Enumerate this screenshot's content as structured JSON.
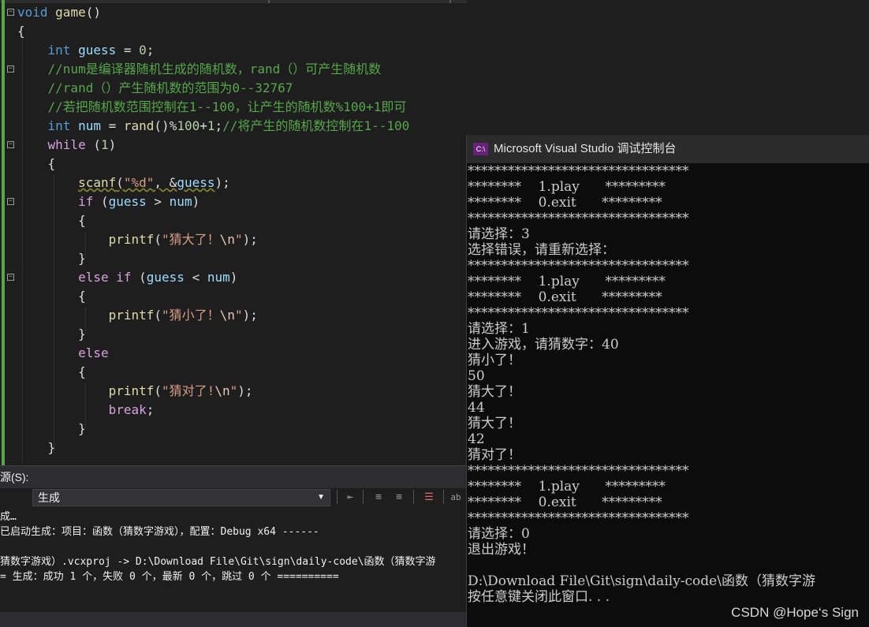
{
  "editor": {
    "lines": [
      {
        "tokens": [
          {
            "c": "kw",
            "t": "void"
          },
          {
            "c": "",
            "t": " "
          },
          {
            "c": "fn",
            "t": "game"
          },
          {
            "c": "",
            "t": "()"
          }
        ]
      },
      {
        "tokens": [
          {
            "c": "",
            "t": "{"
          }
        ]
      },
      {
        "tokens": [
          {
            "c": "",
            "t": "    "
          },
          {
            "c": "ty",
            "t": "int"
          },
          {
            "c": "",
            "t": " "
          },
          {
            "c": "var",
            "t": "guess"
          },
          {
            "c": "",
            "t": " = "
          },
          {
            "c": "num",
            "t": "0"
          },
          {
            "c": "",
            "t": ";"
          }
        ]
      },
      {
        "tokens": [
          {
            "c": "",
            "t": "    "
          },
          {
            "c": "cm",
            "t": "//num是编译器随机生成的随机数，rand（）可产生随机数"
          }
        ]
      },
      {
        "tokens": [
          {
            "c": "",
            "t": "    "
          },
          {
            "c": "cm",
            "t": "//rand（）产生随机数的范围为0--32767"
          }
        ]
      },
      {
        "tokens": [
          {
            "c": "",
            "t": "    "
          },
          {
            "c": "cm",
            "t": "//若把随机数范围控制在1--100，让产生的随机数%100+1即可"
          }
        ]
      },
      {
        "tokens": [
          {
            "c": "",
            "t": "    "
          },
          {
            "c": "ty",
            "t": "int"
          },
          {
            "c": "",
            "t": " "
          },
          {
            "c": "var",
            "t": "num"
          },
          {
            "c": "",
            "t": " = "
          },
          {
            "c": "fn",
            "t": "rand"
          },
          {
            "c": "",
            "t": "()%"
          },
          {
            "c": "num",
            "t": "100"
          },
          {
            "c": "",
            "t": "+"
          },
          {
            "c": "num",
            "t": "1"
          },
          {
            "c": "",
            "t": ";"
          },
          {
            "c": "cm",
            "t": "//将产生的随机数控制在1--100"
          }
        ]
      },
      {
        "tokens": [
          {
            "c": "",
            "t": "    "
          },
          {
            "c": "ctrl",
            "t": "while"
          },
          {
            "c": "",
            "t": " ("
          },
          {
            "c": "num",
            "t": "1"
          },
          {
            "c": "",
            "t": ")"
          }
        ]
      },
      {
        "tokens": [
          {
            "c": "",
            "t": "    {"
          }
        ]
      },
      {
        "tokens": [
          {
            "c": "",
            "t": "        "
          },
          {
            "c": "fn squig",
            "t": "scanf"
          },
          {
            "c": "squig",
            "t": "("
          },
          {
            "c": "str squig",
            "t": "\"%d\""
          },
          {
            "c": "squig",
            "t": ", &"
          },
          {
            "c": "var squig",
            "t": "guess"
          },
          {
            "c": "",
            "t": ");"
          }
        ]
      },
      {
        "tokens": [
          {
            "c": "",
            "t": "        "
          },
          {
            "c": "ctrl",
            "t": "if"
          },
          {
            "c": "",
            "t": " ("
          },
          {
            "c": "var",
            "t": "guess"
          },
          {
            "c": "",
            "t": " > "
          },
          {
            "c": "var",
            "t": "num"
          },
          {
            "c": "",
            "t": ")"
          }
        ]
      },
      {
        "tokens": [
          {
            "c": "",
            "t": "        {"
          }
        ]
      },
      {
        "tokens": [
          {
            "c": "",
            "t": "            "
          },
          {
            "c": "fn",
            "t": "printf"
          },
          {
            "c": "",
            "t": "("
          },
          {
            "c": "str",
            "t": "\"猜大了！"
          },
          {
            "c": "esc",
            "t": "\\n"
          },
          {
            "c": "str",
            "t": "\""
          },
          {
            "c": "",
            "t": ");"
          }
        ]
      },
      {
        "tokens": [
          {
            "c": "",
            "t": "        }"
          }
        ]
      },
      {
        "tokens": [
          {
            "c": "",
            "t": "        "
          },
          {
            "c": "ctrl",
            "t": "else"
          },
          {
            "c": "",
            "t": " "
          },
          {
            "c": "ctrl",
            "t": "if"
          },
          {
            "c": "",
            "t": " ("
          },
          {
            "c": "var",
            "t": "guess"
          },
          {
            "c": "",
            "t": " < "
          },
          {
            "c": "var",
            "t": "num"
          },
          {
            "c": "",
            "t": ")"
          }
        ]
      },
      {
        "tokens": [
          {
            "c": "",
            "t": "        {"
          }
        ]
      },
      {
        "tokens": [
          {
            "c": "",
            "t": "            "
          },
          {
            "c": "fn",
            "t": "printf"
          },
          {
            "c": "",
            "t": "("
          },
          {
            "c": "str",
            "t": "\"猜小了！"
          },
          {
            "c": "esc",
            "t": "\\n"
          },
          {
            "c": "str",
            "t": "\""
          },
          {
            "c": "",
            "t": ");"
          }
        ]
      },
      {
        "tokens": [
          {
            "c": "",
            "t": "        }"
          }
        ]
      },
      {
        "tokens": [
          {
            "c": "",
            "t": "        "
          },
          {
            "c": "ctrl",
            "t": "else"
          }
        ]
      },
      {
        "tokens": [
          {
            "c": "",
            "t": "        {"
          }
        ]
      },
      {
        "tokens": [
          {
            "c": "",
            "t": "            "
          },
          {
            "c": "fn",
            "t": "printf"
          },
          {
            "c": "",
            "t": "("
          },
          {
            "c": "str",
            "t": "\"猜对了!"
          },
          {
            "c": "esc",
            "t": "\\n"
          },
          {
            "c": "str",
            "t": "\""
          },
          {
            "c": "",
            "t": ");"
          }
        ]
      },
      {
        "tokens": [
          {
            "c": "",
            "t": "            "
          },
          {
            "c": "ctrl",
            "t": "break"
          },
          {
            "c": "",
            "t": ";"
          }
        ]
      },
      {
        "tokens": [
          {
            "c": "",
            "t": "        }"
          }
        ]
      },
      {
        "tokens": [
          {
            "c": "",
            "t": "    }"
          }
        ]
      }
    ]
  },
  "output_panel": {
    "source_label": "源(S):",
    "source_value": "生成",
    "lines": [
      "成…",
      "已启动生成：项目：函数（猜数字游戏），配置：Debug x64 ------",
      "",
      "猜数字游戏）.vcxproj -> D:\\Download File\\Git\\sign\\daily-code\\函数（猜数字游",
      "= 生成：成功 1 个，失败 0 个，最新 0 个，跳过 0 个 =========="
    ]
  },
  "console": {
    "title": "Microsoft Visual Studio 调试控制台",
    "icon_text": "C:\\",
    "lines": [
      "*********************************",
      "********    1.play      *********",
      "********    0.exit      *********",
      "*********************************",
      "请选择：3",
      "选择错误，请重新选择：",
      "*********************************",
      "********    1.play      *********",
      "********    0.exit      *********",
      "*********************************",
      "请选择：1",
      "进入游戏，请猜数字：40",
      "猜小了！",
      "50",
      "猜大了！",
      "44",
      "猜大了！",
      "42",
      "猜对了！",
      "*********************************",
      "********    1.play      *********",
      "********    0.exit      *********",
      "*********************************",
      "请选择：0",
      "退出游戏！",
      "",
      "D:\\Download File\\Git\\sign\\daily-code\\函数（猜数字游",
      "按任意键关闭此窗口. . ."
    ]
  },
  "watermark": "CSDN @Hope‘s Sign",
  "colors": {
    "keyword": "#569cd6",
    "control": "#d8a0df",
    "function": "#dcdcaa",
    "variable": "#9cdcfe",
    "number": "#b5cea8",
    "string": "#d69d85",
    "comment": "#57a64a",
    "console_bg": "#0c0c0c",
    "editor_bg": "#1e1e1e"
  }
}
